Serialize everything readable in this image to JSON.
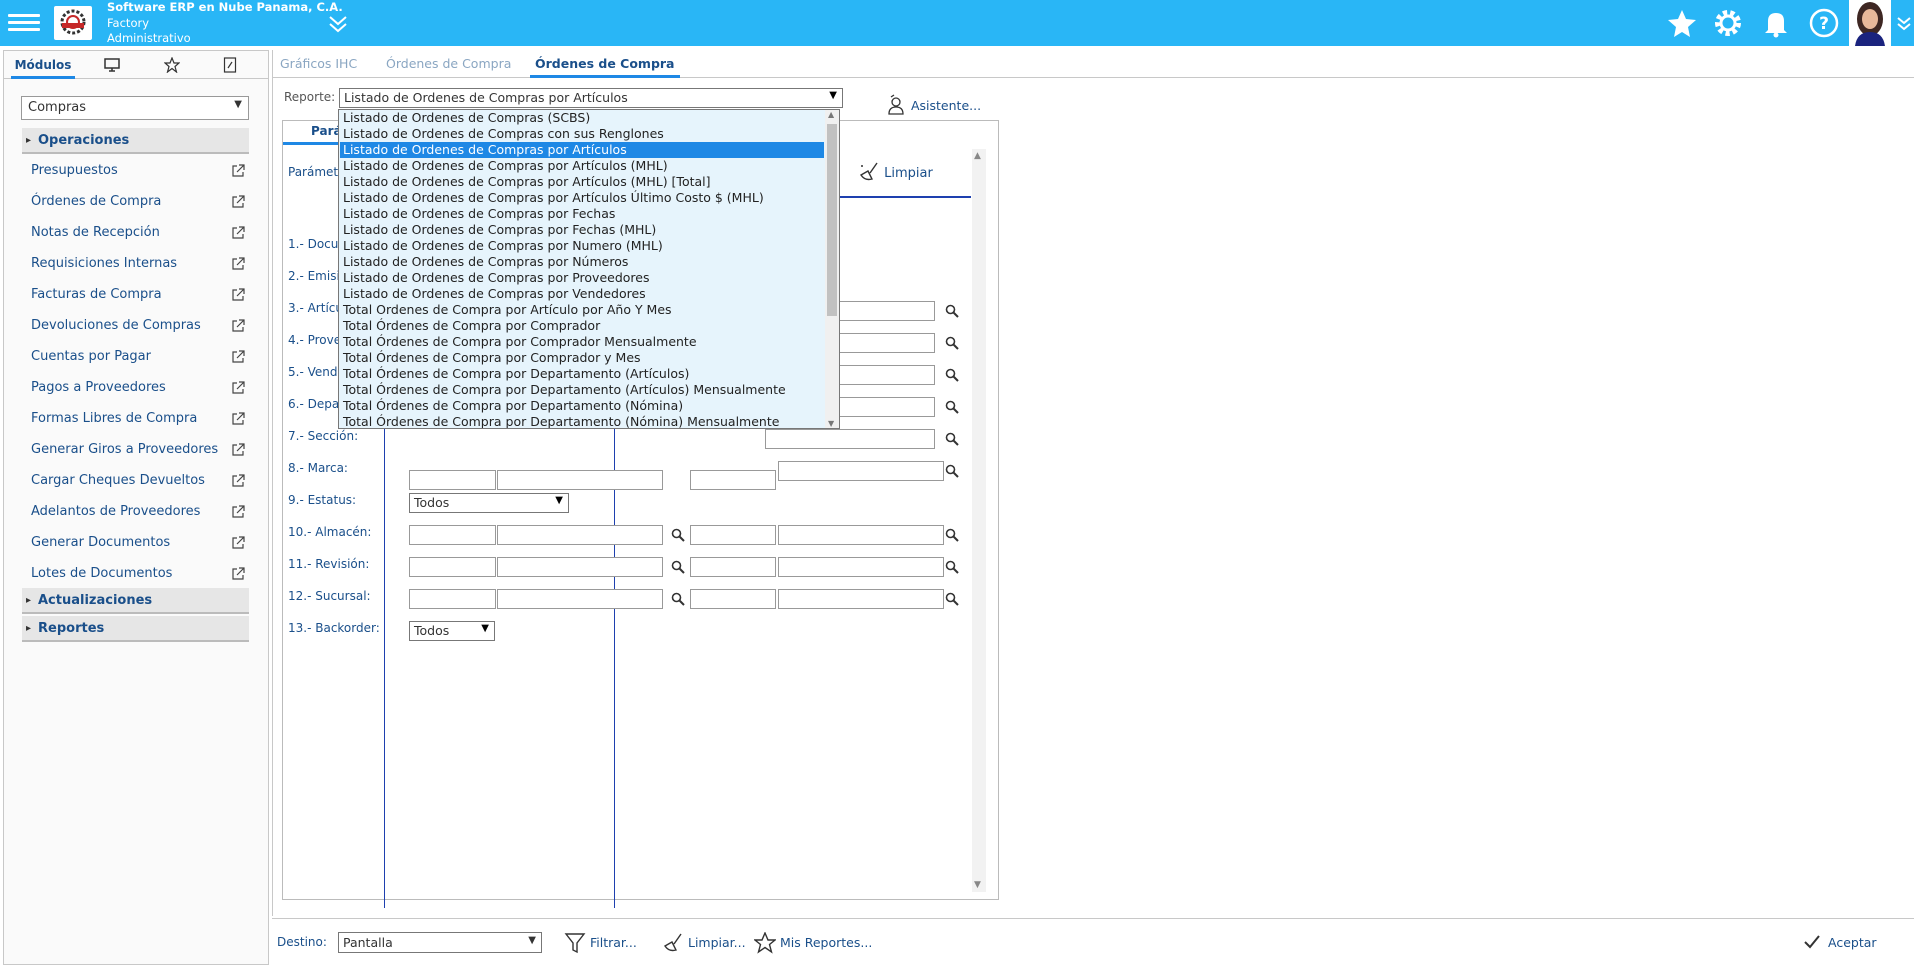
{
  "header": {
    "company": "Software ERP en Nube Panama, C.A.",
    "subtitle1": "Factory",
    "subtitle2": "Administrativo",
    "icons": [
      "menu-icon",
      "star-icon",
      "gear-icon",
      "bell-icon",
      "help-icon"
    ],
    "accent_color": "#29b6f6"
  },
  "left_tabs": {
    "modulos": "Módulos",
    "icons": [
      "monitor-icon",
      "star-icon",
      "attach-icon"
    ]
  },
  "module_select": "Compras",
  "groups": {
    "operaciones": "Operaciones",
    "actualizaciones": "Actualizaciones",
    "reportes": "Reportes"
  },
  "operaciones_items": [
    "Presupuestos",
    "Órdenes de Compra",
    "Notas de Recepción",
    "Requisiciones Internas",
    "Facturas de Compra",
    "Devoluciones de Compras",
    "Cuentas por Pagar",
    "Pagos a Proveedores",
    "Formas Libres de Compra",
    "Generar Giros a Proveedores",
    "Cargar Cheques Devueltos",
    "Adelantos de Proveedores",
    "Generar Documentos",
    "Lotes de Documentos"
  ],
  "main_tabs": [
    "Gráficos IHC",
    "Órdenes de Compra",
    "Órdenes de Compra"
  ],
  "report": {
    "label": "Reporte:",
    "selected": "Listado de Ordenes de Compras por Artículos",
    "asistente": "Asistente..."
  },
  "params": {
    "tab": "Parámetros",
    "header": "Parámetros",
    "limpiar": "Limpiar",
    "rows": [
      "1.- Documento:",
      "2.- Emisión:",
      "3.- Artículo:",
      "4.- Proveedor:",
      "5.- Vendedor:",
      "6.- Departamento:",
      "7.- Sección:",
      "8.- Marca:",
      "9.- Estatus:",
      "10.- Almacén:",
      "11.- Revisión:",
      "12.- Sucursal:",
      "13.- Backorder:"
    ],
    "estatus_value": "Todos",
    "backorder_value": "Todos"
  },
  "dropdown_options": [
    "Listado de Ordenes de Compras (SCBS)",
    "Listado de Ordenes de Compras con sus Renglones",
    "Listado de Ordenes de Compras por Artículos",
    "Listado de Ordenes de Compras por Artículos (MHL)",
    "Listado de Ordenes de Compras por Artículos (MHL) [Total]",
    "Listado de Ordenes de Compras por Artículos Último Costo $ (MHL)",
    "Listado de Ordenes de Compras por Fechas",
    "Listado de Ordenes de Compras por Fechas (MHL)",
    "Listado de Ordenes de Compras por Numero (MHL)",
    "Listado de Ordenes de Compras por Números",
    "Listado de Ordenes de Compras por Proveedores",
    "Listado de Ordenes de Compras por Vendedores",
    "Total Ordenes de Compra por Artículo por Año Y Mes",
    "Total Órdenes de Compra por Comprador",
    "Total Órdenes de Compra por Comprador Mensualmente",
    "Total Órdenes de Compra por Comprador y Mes",
    "Total Órdenes de Compra por Departamento (Artículos)",
    "Total Órdenes de Compra por Departamento (Artículos) Mensualmente",
    "Total Órdenes de Compra por Departamento (Nómina)",
    "Total Órdenes de Compra por Departamento (Nómina) Mensualmente"
  ],
  "bottom": {
    "destino_label": "Destino:",
    "destino_value": "Pantalla",
    "filtrar": "Filtrar...",
    "limpiar": "Limpiar...",
    "mis_reportes": "Mis Reportes...",
    "aceptar": "Aceptar"
  }
}
